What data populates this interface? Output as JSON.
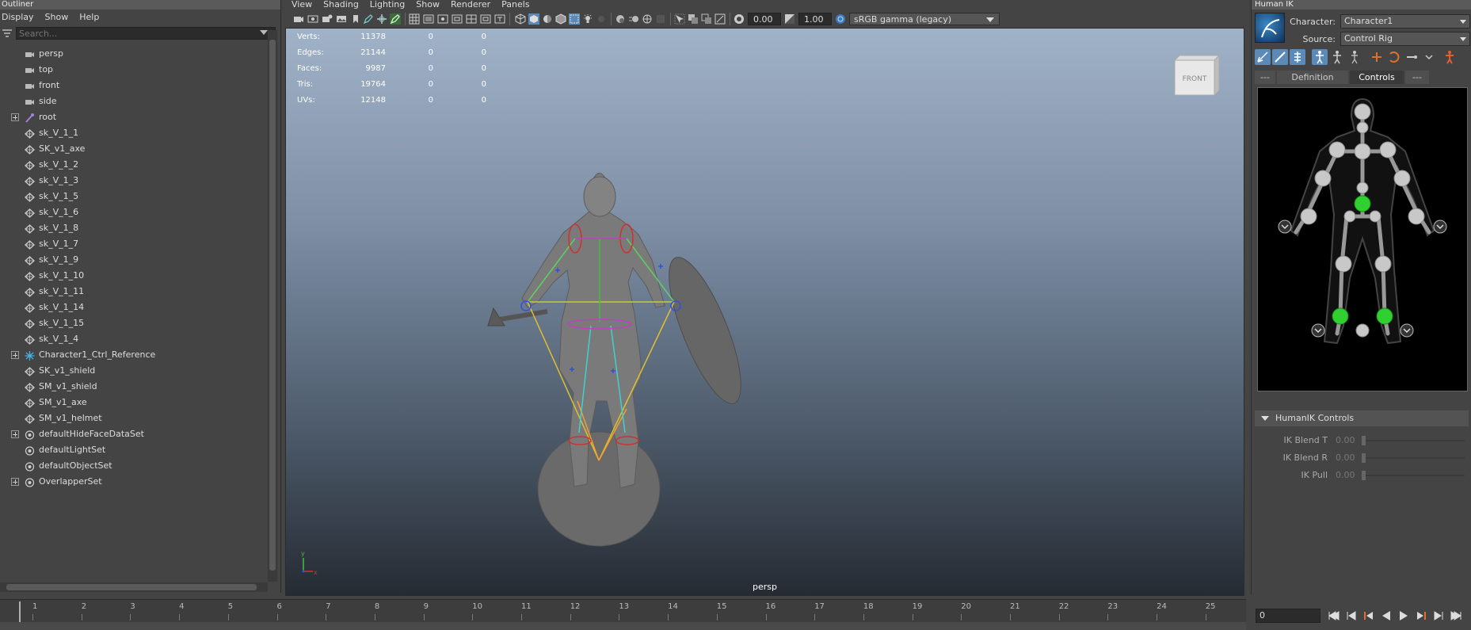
{
  "outliner": {
    "title": "Outliner",
    "menu": [
      "Display",
      "Show",
      "Help"
    ],
    "search_placeholder": "Search...",
    "items": [
      {
        "label": "persp",
        "icon": "camera-icon",
        "expandable": false
      },
      {
        "label": "top",
        "icon": "camera-icon",
        "expandable": false
      },
      {
        "label": "front",
        "icon": "camera-icon",
        "expandable": false
      },
      {
        "label": "side",
        "icon": "camera-icon",
        "expandable": false
      },
      {
        "label": "root",
        "icon": "joint-icon",
        "expandable": true
      },
      {
        "label": "sk_V_1_1",
        "icon": "mesh-icon",
        "expandable": false
      },
      {
        "label": "SK_v1_axe",
        "icon": "mesh-icon",
        "expandable": false
      },
      {
        "label": "sk_V_1_2",
        "icon": "mesh-icon",
        "expandable": false
      },
      {
        "label": "sk_V_1_3",
        "icon": "mesh-icon",
        "expandable": false
      },
      {
        "label": "sk_V_1_5",
        "icon": "mesh-icon",
        "expandable": false
      },
      {
        "label": "sk_V_1_6",
        "icon": "mesh-icon",
        "expandable": false
      },
      {
        "label": "sk_V_1_8",
        "icon": "mesh-icon",
        "expandable": false
      },
      {
        "label": "sk_V_1_7",
        "icon": "mesh-icon",
        "expandable": false
      },
      {
        "label": "sk_V_1_9",
        "icon": "mesh-icon",
        "expandable": false
      },
      {
        "label": "sk_V_1_10",
        "icon": "mesh-icon",
        "expandable": false
      },
      {
        "label": "sk_V_1_11",
        "icon": "mesh-icon",
        "expandable": false
      },
      {
        "label": "sk_V_1_14",
        "icon": "mesh-icon",
        "expandable": false
      },
      {
        "label": "sk_V_1_15",
        "icon": "mesh-icon",
        "expandable": false
      },
      {
        "label": "sk_V_1_4",
        "icon": "mesh-icon",
        "expandable": false
      },
      {
        "label": "Character1_Ctrl_Reference",
        "icon": "hik-reference-icon",
        "expandable": true
      },
      {
        "label": "SK_v1_shield",
        "icon": "mesh-icon",
        "expandable": false
      },
      {
        "label": "SM_v1_shield",
        "icon": "mesh-icon",
        "expandable": false
      },
      {
        "label": "SM_v1_axe",
        "icon": "mesh-icon",
        "expandable": false
      },
      {
        "label": "SM_v1_helmet",
        "icon": "mesh-icon",
        "expandable": false
      },
      {
        "label": "defaultHideFaceDataSet",
        "icon": "set-icon",
        "expandable": true
      },
      {
        "label": "defaultLightSet",
        "icon": "set-icon",
        "expandable": false
      },
      {
        "label": "defaultObjectSet",
        "icon": "set-icon",
        "expandable": false
      },
      {
        "label": "OverlapperSet",
        "icon": "set-icon",
        "expandable": true
      }
    ]
  },
  "viewport": {
    "menu": [
      "View",
      "Shading",
      "Lighting",
      "Show",
      "Renderer",
      "Panels"
    ],
    "exposure": "0.00",
    "gamma": "1.00",
    "color_space": "sRGB gamma (legacy)",
    "camera": "persp",
    "viewcube_label": "FRONT",
    "axis_labels": {
      "y": "y",
      "x": "x"
    },
    "hud": [
      {
        "label": "Verts:",
        "value": "11378",
        "z1": "0",
        "z2": "0"
      },
      {
        "label": "Edges:",
        "value": "21144",
        "z1": "0",
        "z2": "0"
      },
      {
        "label": "Faces:",
        "value": "9987",
        "z1": "0",
        "z2": "0"
      },
      {
        "label": "Tris:",
        "value": "19764",
        "z1": "0",
        "z2": "0"
      },
      {
        "label": "UVs:",
        "value": "12148",
        "z1": "0",
        "z2": "0"
      }
    ]
  },
  "humanik": {
    "title": "Human IK",
    "character_label": "Character:",
    "character_value": "Character1",
    "source_label": "Source:",
    "source_value": "Control Rig",
    "tabs": [
      "---",
      "Definition",
      "Controls",
      "---"
    ],
    "active_tab": "Controls",
    "controls_header": "HumanIK Controls",
    "sliders": [
      {
        "label": "IK Blend T",
        "value": "0.00"
      },
      {
        "label": "IK Blend R",
        "value": "0.00"
      },
      {
        "label": "IK Pull",
        "value": "0.00"
      }
    ]
  },
  "timeline": {
    "frames": [
      "1",
      "2",
      "3",
      "4",
      "5",
      "6",
      "7",
      "8",
      "9",
      "10",
      "11",
      "12",
      "13",
      "14",
      "15",
      "16",
      "17",
      "18",
      "19",
      "20",
      "21",
      "22",
      "23",
      "24",
      "25"
    ],
    "current_frame": "0"
  }
}
